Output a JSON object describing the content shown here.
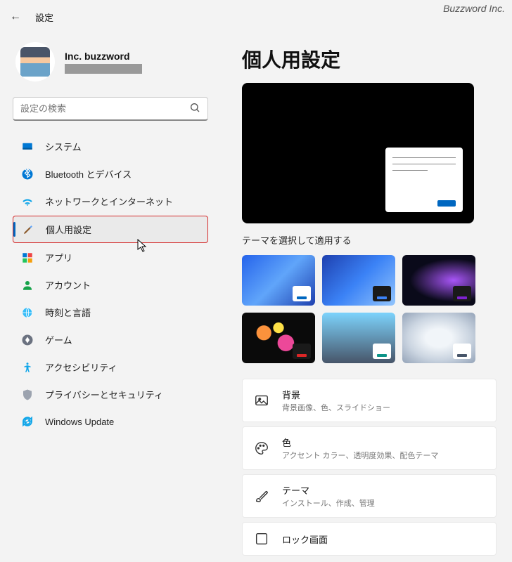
{
  "watermark": "Buzzword Inc.",
  "header": {
    "title": "設定"
  },
  "user": {
    "name": "Inc. buzzword"
  },
  "search": {
    "placeholder": "設定の検索"
  },
  "nav": [
    {
      "id": "system",
      "label": "システム"
    },
    {
      "id": "bluetooth",
      "label": "Bluetooth とデバイス"
    },
    {
      "id": "network",
      "label": "ネットワークとインターネット"
    },
    {
      "id": "personalization",
      "label": "個人用設定",
      "selected": true
    },
    {
      "id": "apps",
      "label": "アプリ"
    },
    {
      "id": "accounts",
      "label": "アカウント"
    },
    {
      "id": "time",
      "label": "時刻と言語"
    },
    {
      "id": "gaming",
      "label": "ゲーム"
    },
    {
      "id": "accessibility",
      "label": "アクセシビリティ"
    },
    {
      "id": "privacy",
      "label": "プライバシーとセキュリティ"
    },
    {
      "id": "update",
      "label": "Windows Update"
    }
  ],
  "main": {
    "title": "個人用設定",
    "theme_section_label": "テーマを選択して適用する",
    "settings": [
      {
        "id": "background",
        "title": "背景",
        "sub": "背景画像、色、スライドショー"
      },
      {
        "id": "color",
        "title": "色",
        "sub": "アクセント カラー、透明度効果、配色テーマ"
      },
      {
        "id": "themes",
        "title": "テーマ",
        "sub": "インストール、作成、管理"
      },
      {
        "id": "lockscreen",
        "title": "ロック画面",
        "sub": ""
      }
    ]
  }
}
